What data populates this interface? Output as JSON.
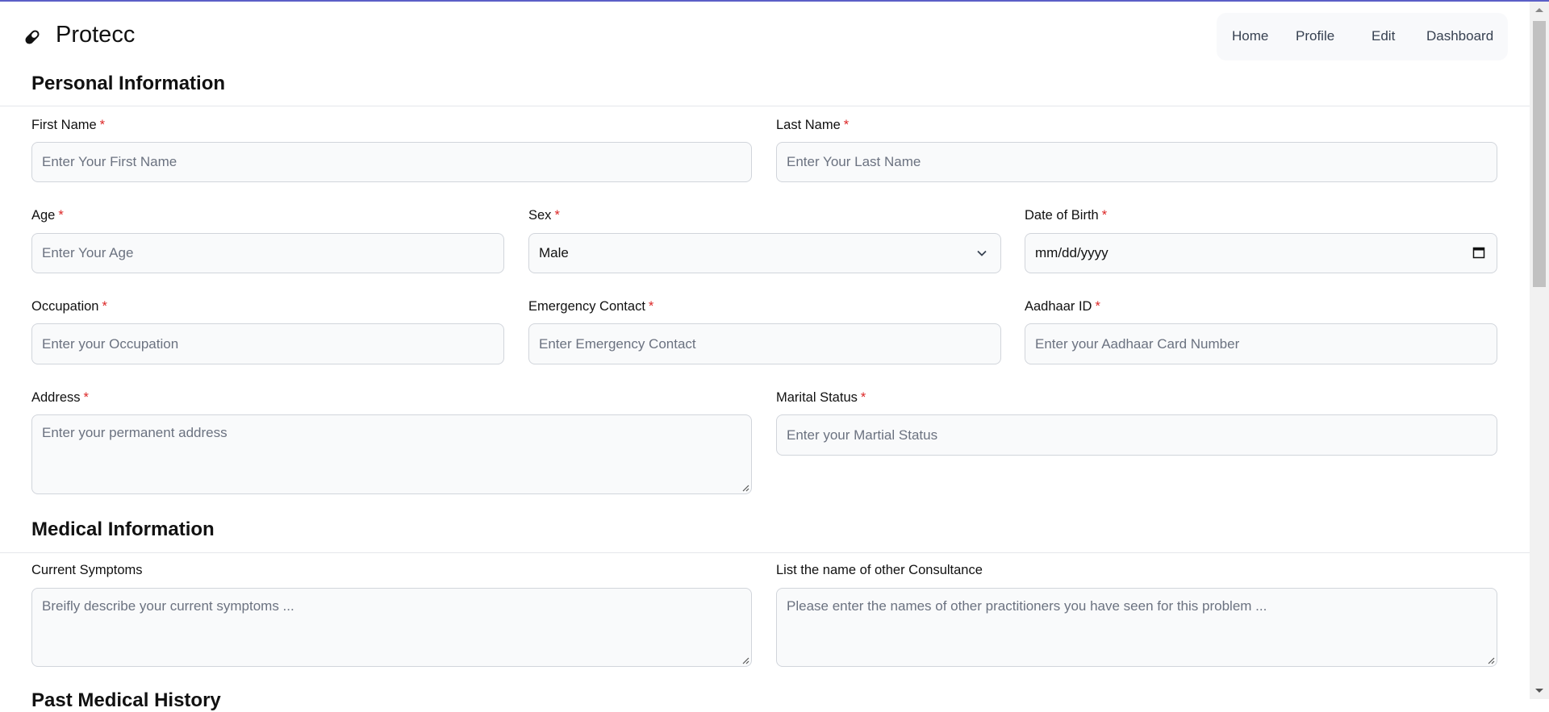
{
  "brand": {
    "name": "Protecc",
    "icon": "pill-icon"
  },
  "nav": {
    "items": [
      "Home",
      "Profile",
      "Edit",
      "Dashboard"
    ]
  },
  "colors": {
    "accent": "#5b5fc7",
    "required": "#dc2626",
    "input_bg": "#f9fafb"
  },
  "sections": {
    "personal": {
      "title": "Personal Information"
    },
    "medical": {
      "title": "Medical Information"
    },
    "past": {
      "title": "Past Medical History"
    }
  },
  "personal": {
    "first_name": {
      "label": "First Name",
      "required": "*",
      "placeholder": "Enter Your First Name"
    },
    "last_name": {
      "label": "Last Name",
      "required": "*",
      "placeholder": "Enter Your Last Name"
    },
    "age": {
      "label": "Age",
      "required": "*",
      "placeholder": "Enter Your Age"
    },
    "sex": {
      "label": "Sex",
      "required": "*",
      "value": "Male"
    },
    "dob": {
      "label": "Date of Birth",
      "required": "*",
      "placeholder": "mm/dd/yyyy"
    },
    "occupation": {
      "label": "Occupation",
      "required": "*",
      "placeholder": "Enter your Occupation"
    },
    "emergency": {
      "label": "Emergency Contact",
      "required": "*",
      "placeholder": "Enter Emergency Contact"
    },
    "aadhaar": {
      "label": "Aadhaar ID",
      "required": "*",
      "placeholder": "Enter your Aadhaar Card Number"
    },
    "address": {
      "label": "Address",
      "required": "*",
      "placeholder": "Enter your permanent address"
    },
    "marital": {
      "label": "Marital Status",
      "required": "*",
      "placeholder": "Enter your Martial Status"
    }
  },
  "medical": {
    "symptoms": {
      "label": "Current Symptoms",
      "placeholder": "Breifly describe your current symptoms ..."
    },
    "consultance": {
      "label": "List the name of other Consultance",
      "placeholder": "Please enter the names of other practitioners you have seen for this problem ..."
    }
  }
}
